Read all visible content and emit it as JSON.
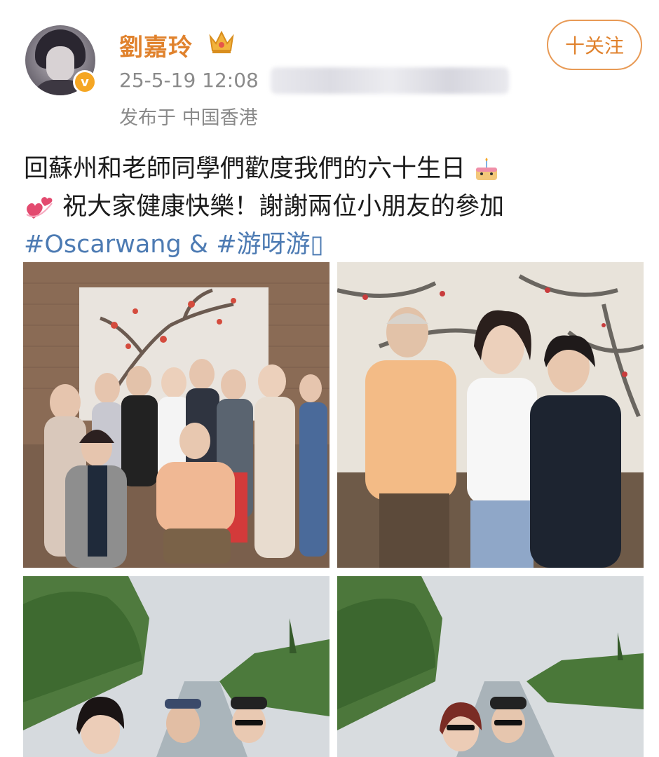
{
  "post": {
    "username": "劉嘉玲",
    "timestamp": "25-5-19 12:08",
    "location": "发布于 中国香港",
    "follow_label": "十关注",
    "text_line1": "回蘇州和老師同學們歡度我們的六十生日",
    "text_line2": "祝大家健康快樂！謝謝兩位小朋友的參加",
    "text_line3": "#Oscarwang & #游呀游▯"
  },
  "icons": {
    "crown": "crown-icon",
    "verified": "verified-badge-icon",
    "cake": "birthday-cake-emoji",
    "hearts": "revolving-hearts-emoji"
  },
  "colors": {
    "username": "#e0822d",
    "hashtag": "#4d7bb3",
    "meta": "#8a8a8a",
    "verified": "#f5a623"
  }
}
